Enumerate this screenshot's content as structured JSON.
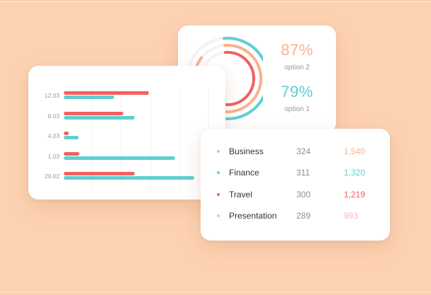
{
  "colors": {
    "background": "#fdd2b2",
    "orange": "#f6b38d",
    "teal": "#5fcfd3",
    "red": "#f2605f",
    "pink": "#f8b8c4"
  },
  "donut_card": {
    "stats": [
      {
        "value": "87%",
        "label": "option 2",
        "color": "#f6b38d"
      },
      {
        "value": "79%",
        "label": "option 1",
        "color": "#5fcfd3"
      }
    ],
    "rings": [
      {
        "color": "#5fcfd3",
        "fraction": 0.79
      },
      {
        "color": "#f6b38d",
        "fraction": 0.87
      },
      {
        "color": "#f2605f",
        "fraction": 0.62
      }
    ]
  },
  "bar_chart": {
    "categories": [
      "12.03",
      "8.03",
      "4.03",
      "1.03",
      "29.02"
    ],
    "series": [
      {
        "color": "#f2605f",
        "values": [
          70,
          49,
          4,
          13,
          58
        ]
      },
      {
        "color": "#5fcfd3",
        "values": [
          41,
          58,
          12,
          91,
          107
        ]
      }
    ]
  },
  "table": {
    "rows": [
      {
        "category": "Business",
        "count": "324",
        "amount": "1,540",
        "color": "#f6b38d"
      },
      {
        "category": "Finance",
        "count": "311",
        "amount": "1,320",
        "color": "#5fcfd3"
      },
      {
        "category": "Travel",
        "count": "300",
        "amount": "1,219",
        "color": "#f2605f"
      },
      {
        "category": "Presentation",
        "count": "289",
        "amount": "993",
        "color": "#f8b8c4"
      }
    ]
  }
}
